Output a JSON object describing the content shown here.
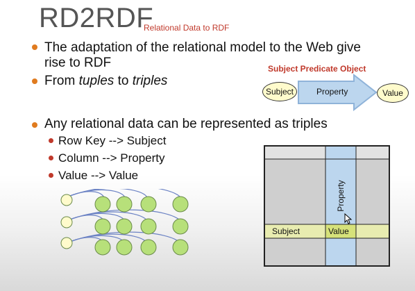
{
  "slide": {
    "title": "RD2RDF",
    "subtitle": "Relational Data to RDF",
    "bullets": [
      "The adaptation of the relational model to the Web give rise to RDF",
      "From tuples to triples",
      "Any relational data can be represented as triples"
    ],
    "bullet2_parts": {
      "pre": "From ",
      "em1": "tuples",
      "mid": " to ",
      "em2": "triples"
    },
    "bullet1_lines": [
      "The adaptation of the relational model to the Web give",
      "rise to RDF"
    ],
    "subbullets": [
      "Row Key --> Subject",
      "Column --> Property",
      "Value --> Value"
    ]
  },
  "triple_diagram": {
    "heading": "Subject Predicate Object",
    "subject": "Subject",
    "property": "Property",
    "value": "Value"
  },
  "table_diagram": {
    "column_label": "Property",
    "row_label": "Subject",
    "cell_label": "Value"
  },
  "colors": {
    "accent_red": "#c0392b",
    "bullet_orange": "#e07b1f",
    "node_green": "#b7e07a",
    "arrow_blue": "#bcd6ee",
    "row_yellow": "#e8ecb0"
  }
}
